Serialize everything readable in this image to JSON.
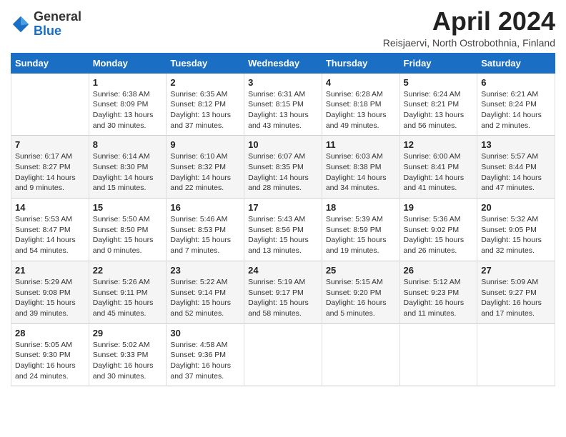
{
  "header": {
    "logo_general": "General",
    "logo_blue": "Blue",
    "month_title": "April 2024",
    "subtitle": "Reisjaervi, North Ostrobothnia, Finland"
  },
  "calendar": {
    "weekdays": [
      "Sunday",
      "Monday",
      "Tuesday",
      "Wednesday",
      "Thursday",
      "Friday",
      "Saturday"
    ],
    "weeks": [
      [
        {
          "day": "",
          "info": ""
        },
        {
          "day": "1",
          "info": "Sunrise: 6:38 AM\nSunset: 8:09 PM\nDaylight: 13 hours\nand 30 minutes."
        },
        {
          "day": "2",
          "info": "Sunrise: 6:35 AM\nSunset: 8:12 PM\nDaylight: 13 hours\nand 37 minutes."
        },
        {
          "day": "3",
          "info": "Sunrise: 6:31 AM\nSunset: 8:15 PM\nDaylight: 13 hours\nand 43 minutes."
        },
        {
          "day": "4",
          "info": "Sunrise: 6:28 AM\nSunset: 8:18 PM\nDaylight: 13 hours\nand 49 minutes."
        },
        {
          "day": "5",
          "info": "Sunrise: 6:24 AM\nSunset: 8:21 PM\nDaylight: 13 hours\nand 56 minutes."
        },
        {
          "day": "6",
          "info": "Sunrise: 6:21 AM\nSunset: 8:24 PM\nDaylight: 14 hours\nand 2 minutes."
        }
      ],
      [
        {
          "day": "7",
          "info": "Sunrise: 6:17 AM\nSunset: 8:27 PM\nDaylight: 14 hours\nand 9 minutes."
        },
        {
          "day": "8",
          "info": "Sunrise: 6:14 AM\nSunset: 8:30 PM\nDaylight: 14 hours\nand 15 minutes."
        },
        {
          "day": "9",
          "info": "Sunrise: 6:10 AM\nSunset: 8:32 PM\nDaylight: 14 hours\nand 22 minutes."
        },
        {
          "day": "10",
          "info": "Sunrise: 6:07 AM\nSunset: 8:35 PM\nDaylight: 14 hours\nand 28 minutes."
        },
        {
          "day": "11",
          "info": "Sunrise: 6:03 AM\nSunset: 8:38 PM\nDaylight: 14 hours\nand 34 minutes."
        },
        {
          "day": "12",
          "info": "Sunrise: 6:00 AM\nSunset: 8:41 PM\nDaylight: 14 hours\nand 41 minutes."
        },
        {
          "day": "13",
          "info": "Sunrise: 5:57 AM\nSunset: 8:44 PM\nDaylight: 14 hours\nand 47 minutes."
        }
      ],
      [
        {
          "day": "14",
          "info": "Sunrise: 5:53 AM\nSunset: 8:47 PM\nDaylight: 14 hours\nand 54 minutes."
        },
        {
          "day": "15",
          "info": "Sunrise: 5:50 AM\nSunset: 8:50 PM\nDaylight: 15 hours\nand 0 minutes."
        },
        {
          "day": "16",
          "info": "Sunrise: 5:46 AM\nSunset: 8:53 PM\nDaylight: 15 hours\nand 7 minutes."
        },
        {
          "day": "17",
          "info": "Sunrise: 5:43 AM\nSunset: 8:56 PM\nDaylight: 15 hours\nand 13 minutes."
        },
        {
          "day": "18",
          "info": "Sunrise: 5:39 AM\nSunset: 8:59 PM\nDaylight: 15 hours\nand 19 minutes."
        },
        {
          "day": "19",
          "info": "Sunrise: 5:36 AM\nSunset: 9:02 PM\nDaylight: 15 hours\nand 26 minutes."
        },
        {
          "day": "20",
          "info": "Sunrise: 5:32 AM\nSunset: 9:05 PM\nDaylight: 15 hours\nand 32 minutes."
        }
      ],
      [
        {
          "day": "21",
          "info": "Sunrise: 5:29 AM\nSunset: 9:08 PM\nDaylight: 15 hours\nand 39 minutes."
        },
        {
          "day": "22",
          "info": "Sunrise: 5:26 AM\nSunset: 9:11 PM\nDaylight: 15 hours\nand 45 minutes."
        },
        {
          "day": "23",
          "info": "Sunrise: 5:22 AM\nSunset: 9:14 PM\nDaylight: 15 hours\nand 52 minutes."
        },
        {
          "day": "24",
          "info": "Sunrise: 5:19 AM\nSunset: 9:17 PM\nDaylight: 15 hours\nand 58 minutes."
        },
        {
          "day": "25",
          "info": "Sunrise: 5:15 AM\nSunset: 9:20 PM\nDaylight: 16 hours\nand 5 minutes."
        },
        {
          "day": "26",
          "info": "Sunrise: 5:12 AM\nSunset: 9:23 PM\nDaylight: 16 hours\nand 11 minutes."
        },
        {
          "day": "27",
          "info": "Sunrise: 5:09 AM\nSunset: 9:27 PM\nDaylight: 16 hours\nand 17 minutes."
        }
      ],
      [
        {
          "day": "28",
          "info": "Sunrise: 5:05 AM\nSunset: 9:30 PM\nDaylight: 16 hours\nand 24 minutes."
        },
        {
          "day": "29",
          "info": "Sunrise: 5:02 AM\nSunset: 9:33 PM\nDaylight: 16 hours\nand 30 minutes."
        },
        {
          "day": "30",
          "info": "Sunrise: 4:58 AM\nSunset: 9:36 PM\nDaylight: 16 hours\nand 37 minutes."
        },
        {
          "day": "",
          "info": ""
        },
        {
          "day": "",
          "info": ""
        },
        {
          "day": "",
          "info": ""
        },
        {
          "day": "",
          "info": ""
        }
      ]
    ]
  }
}
